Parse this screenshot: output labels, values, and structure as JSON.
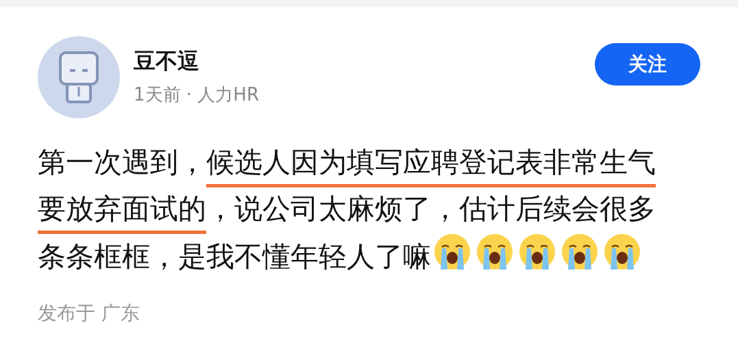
{
  "author": {
    "name": "豆不逗",
    "meta": "1天前 · 人力HR"
  },
  "follow_button": {
    "label": "关注"
  },
  "post": {
    "segments": [
      {
        "text": "第一次遇到，",
        "underlined": false
      },
      {
        "text": "候选人因为填写应聘登记表非常生气要放弃面试的",
        "underlined": true
      },
      {
        "text": "，说公司太麻烦了，估计后续会很多条条框框，是我不懂年轻人了嘛",
        "underlined": false
      }
    ],
    "emojis": [
      {
        "kind": "crying"
      },
      {
        "kind": "crying"
      },
      {
        "kind": "crying"
      },
      {
        "kind": "crying"
      },
      {
        "kind": "crying"
      }
    ]
  },
  "location": "发布于 广东"
}
